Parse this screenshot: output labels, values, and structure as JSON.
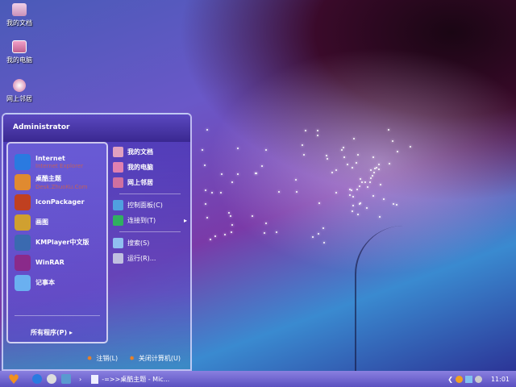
{
  "desktop": [
    {
      "label": "我的文档",
      "icon": "folder-icon"
    },
    {
      "label": "我的电脑",
      "icon": "computer-icon"
    },
    {
      "label": "网上邻居",
      "icon": "network-icon"
    }
  ],
  "menu": {
    "user": "Administrator",
    "left": [
      {
        "label": "Internet",
        "sub": "Internet Explorer",
        "color": "#2a7ae0"
      },
      {
        "label": "桌酷主题",
        "sub": "Desk.ZhuoKu.Com",
        "color": "#e08a30"
      },
      {
        "label": "IconPackager",
        "color": "#c04020"
      },
      {
        "label": "画图",
        "color": "#d0a030"
      },
      {
        "label": "KMPlayer中文版",
        "color": "#3a6ab0"
      },
      {
        "label": "WinRAR",
        "color": "#8a2a8a"
      },
      {
        "label": "记事本",
        "color": "#6ab0f0"
      }
    ],
    "all_programs": "所有程序(P)",
    "right": [
      {
        "label": "我的文档",
        "color": "#e0a0c0"
      },
      {
        "label": "我的电脑",
        "color": "#e080b0"
      },
      {
        "label": "网上邻居",
        "color": "#d070a0"
      },
      {
        "label": "控制面板(C)",
        "color": "#50a0e0"
      },
      {
        "label": "连接到(T)",
        "color": "#30b060"
      },
      {
        "label": "搜索(S)",
        "color": "#90c0f0"
      },
      {
        "label": "运行(R)...",
        "color": "#c0c0e0"
      }
    ],
    "logoff": "注销(L)",
    "shutdown": "关闭计算机(U)"
  },
  "taskbar": {
    "window": "-=>>桌酷主题 - Mic...",
    "clock": "11:01"
  }
}
